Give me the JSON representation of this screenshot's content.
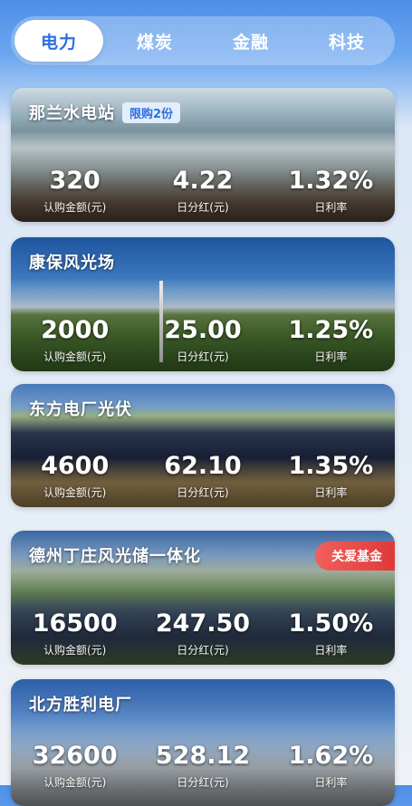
{
  "tabs": [
    {
      "label": "电力",
      "active": true
    },
    {
      "label": "煤炭",
      "active": false
    },
    {
      "label": "金融",
      "active": false
    },
    {
      "label": "科技",
      "active": false
    }
  ],
  "projects": [
    {
      "title": "那兰水电站",
      "badge": "限购2份",
      "stats": [
        {
          "value": "320",
          "label": "认购金额(元)"
        },
        {
          "value": "4.22",
          "label": "日分红(元)"
        },
        {
          "value": "1.32%",
          "label": "日利率"
        }
      ]
    },
    {
      "title": "康保风光场",
      "stats": [
        {
          "value": "2000",
          "label": "认购金额(元)"
        },
        {
          "value": "25.00",
          "label": "日分红(元)"
        },
        {
          "value": "1.25%",
          "label": "日利率"
        }
      ]
    },
    {
      "title": "东方电厂光伏",
      "stats": [
        {
          "value": "4600",
          "label": "认购金额(元)"
        },
        {
          "value": "62.10",
          "label": "日分红(元)"
        },
        {
          "value": "1.35%",
          "label": "日利率"
        }
      ]
    },
    {
      "title": "德州丁庄风光储一体化",
      "tag": "关爱基金",
      "stats": [
        {
          "value": "16500",
          "label": "认购金额(元)"
        },
        {
          "value": "247.50",
          "label": "日分红(元)"
        },
        {
          "value": "1.50%",
          "label": "日利率"
        }
      ]
    },
    {
      "title": "北方胜利电厂",
      "stats": [
        {
          "value": "32600",
          "label": "认购金额(元)"
        },
        {
          "value": "528.12",
          "label": "日分红(元)"
        },
        {
          "value": "1.62%",
          "label": "日利率"
        }
      ]
    }
  ]
}
